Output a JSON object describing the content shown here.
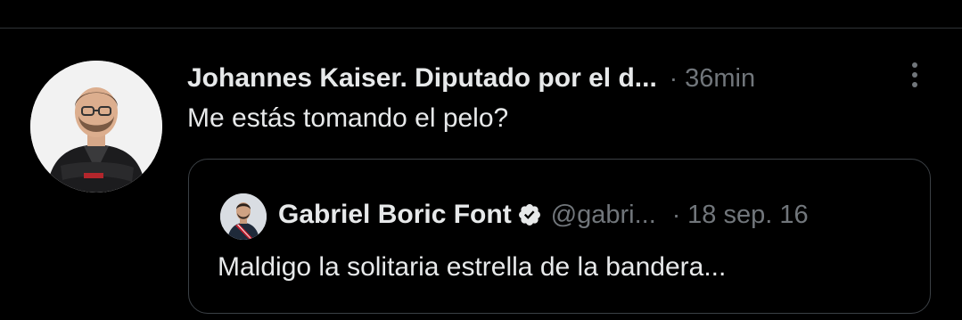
{
  "tweet": {
    "author_name": "Johannes Kaiser. Diputado por el d...",
    "separator": "·",
    "timestamp": "36min",
    "text": "Me estás tomando el pelo?",
    "avatar_icon": "person-avatar"
  },
  "quote": {
    "author_name": "Gabriel Boric Font",
    "verified_icon": "verified-badge-icon",
    "handle": "@gabri...",
    "separator": "·",
    "date": "18 sep. 16",
    "text": "Maldigo la solitaria estrella de la bandera..."
  },
  "more_icon": "more-options-icon",
  "colors": {
    "background": "#000000",
    "primary_text": "#e7e9ea",
    "secondary_text": "#71767b",
    "border": "#3b4045"
  }
}
